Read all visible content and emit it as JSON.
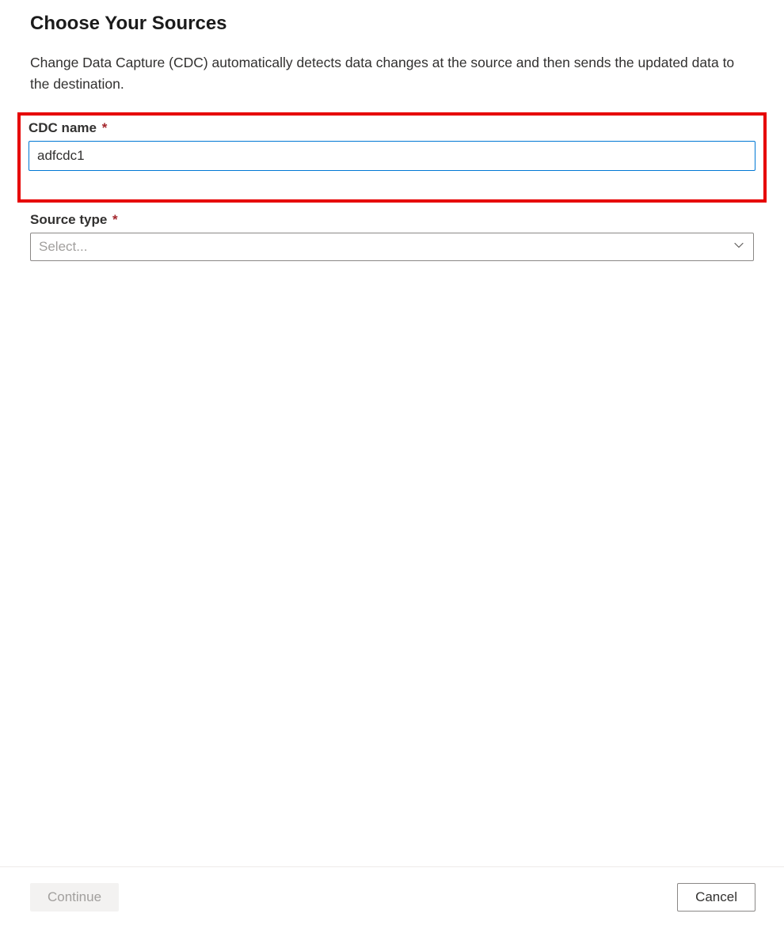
{
  "page": {
    "title": "Choose Your Sources",
    "description": "Change Data Capture (CDC) automatically detects data changes at the source and then sends the updated data to the destination."
  },
  "form": {
    "cdc_name": {
      "label": "CDC name",
      "value": "adfcdc1",
      "required_marker": "*"
    },
    "source_type": {
      "label": "Source type",
      "placeholder": "Select...",
      "required_marker": "*"
    }
  },
  "footer": {
    "continue_label": "Continue",
    "cancel_label": "Cancel"
  }
}
